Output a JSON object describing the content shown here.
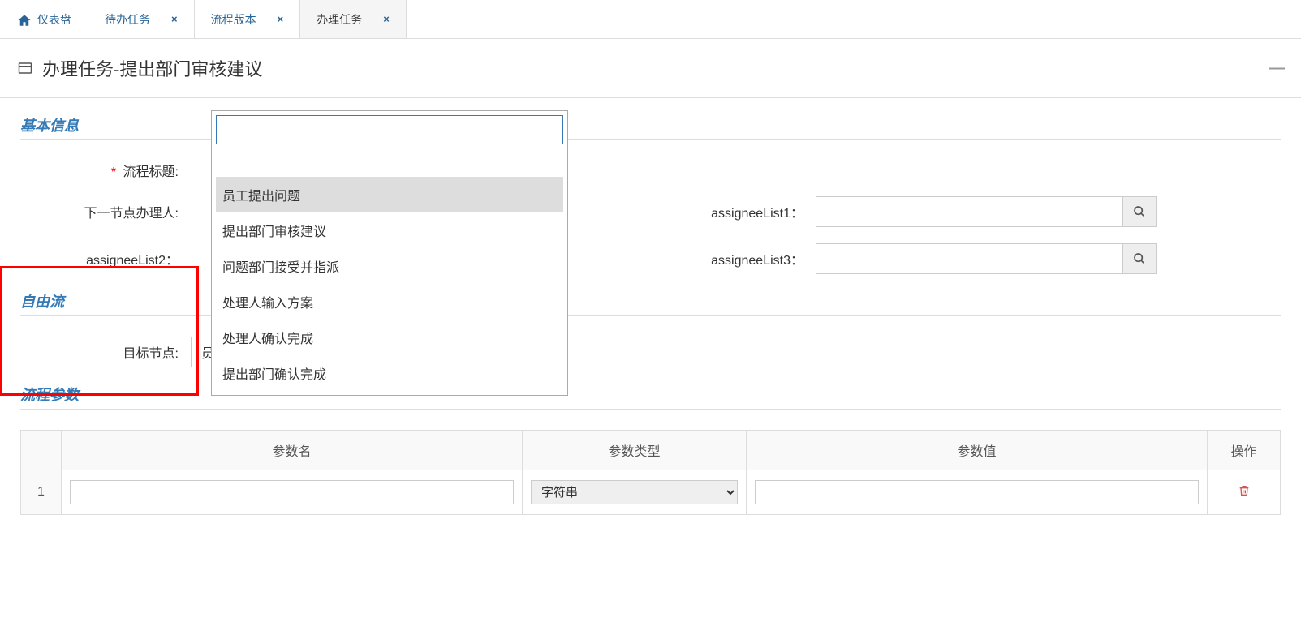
{
  "tabs": {
    "dashboard": "仪表盘",
    "pending": "待办任务",
    "version": "流程版本",
    "handle": "办理任务"
  },
  "header": {
    "title": "办理任务-提出部门审核建议"
  },
  "sections": {
    "basic": "基本信息",
    "freeflow": "自由流",
    "params": "流程参数"
  },
  "form": {
    "process_title_label": "流程标题:",
    "next_handler_label": "下一节点办理人:",
    "assignee1_label": "assigneeList1：",
    "assignee2_label": "assigneeList2：",
    "assignee3_label": "assigneeList3：",
    "target_node_label": "目标节点:",
    "target_node_value": "员工提出问题"
  },
  "dropdown": {
    "options": {
      "opt0": "员工提出问题",
      "opt1": "提出部门审核建议",
      "opt2": "问题部门接受并指派",
      "opt3": "处理人输入方案",
      "opt4": "处理人确认完成",
      "opt5": "提出部门确认完成"
    }
  },
  "table": {
    "headers": {
      "name": "参数名",
      "type": "参数类型",
      "value": "参数值",
      "op": "操作"
    },
    "row1": {
      "num": "1",
      "type_value": "字符串"
    }
  }
}
